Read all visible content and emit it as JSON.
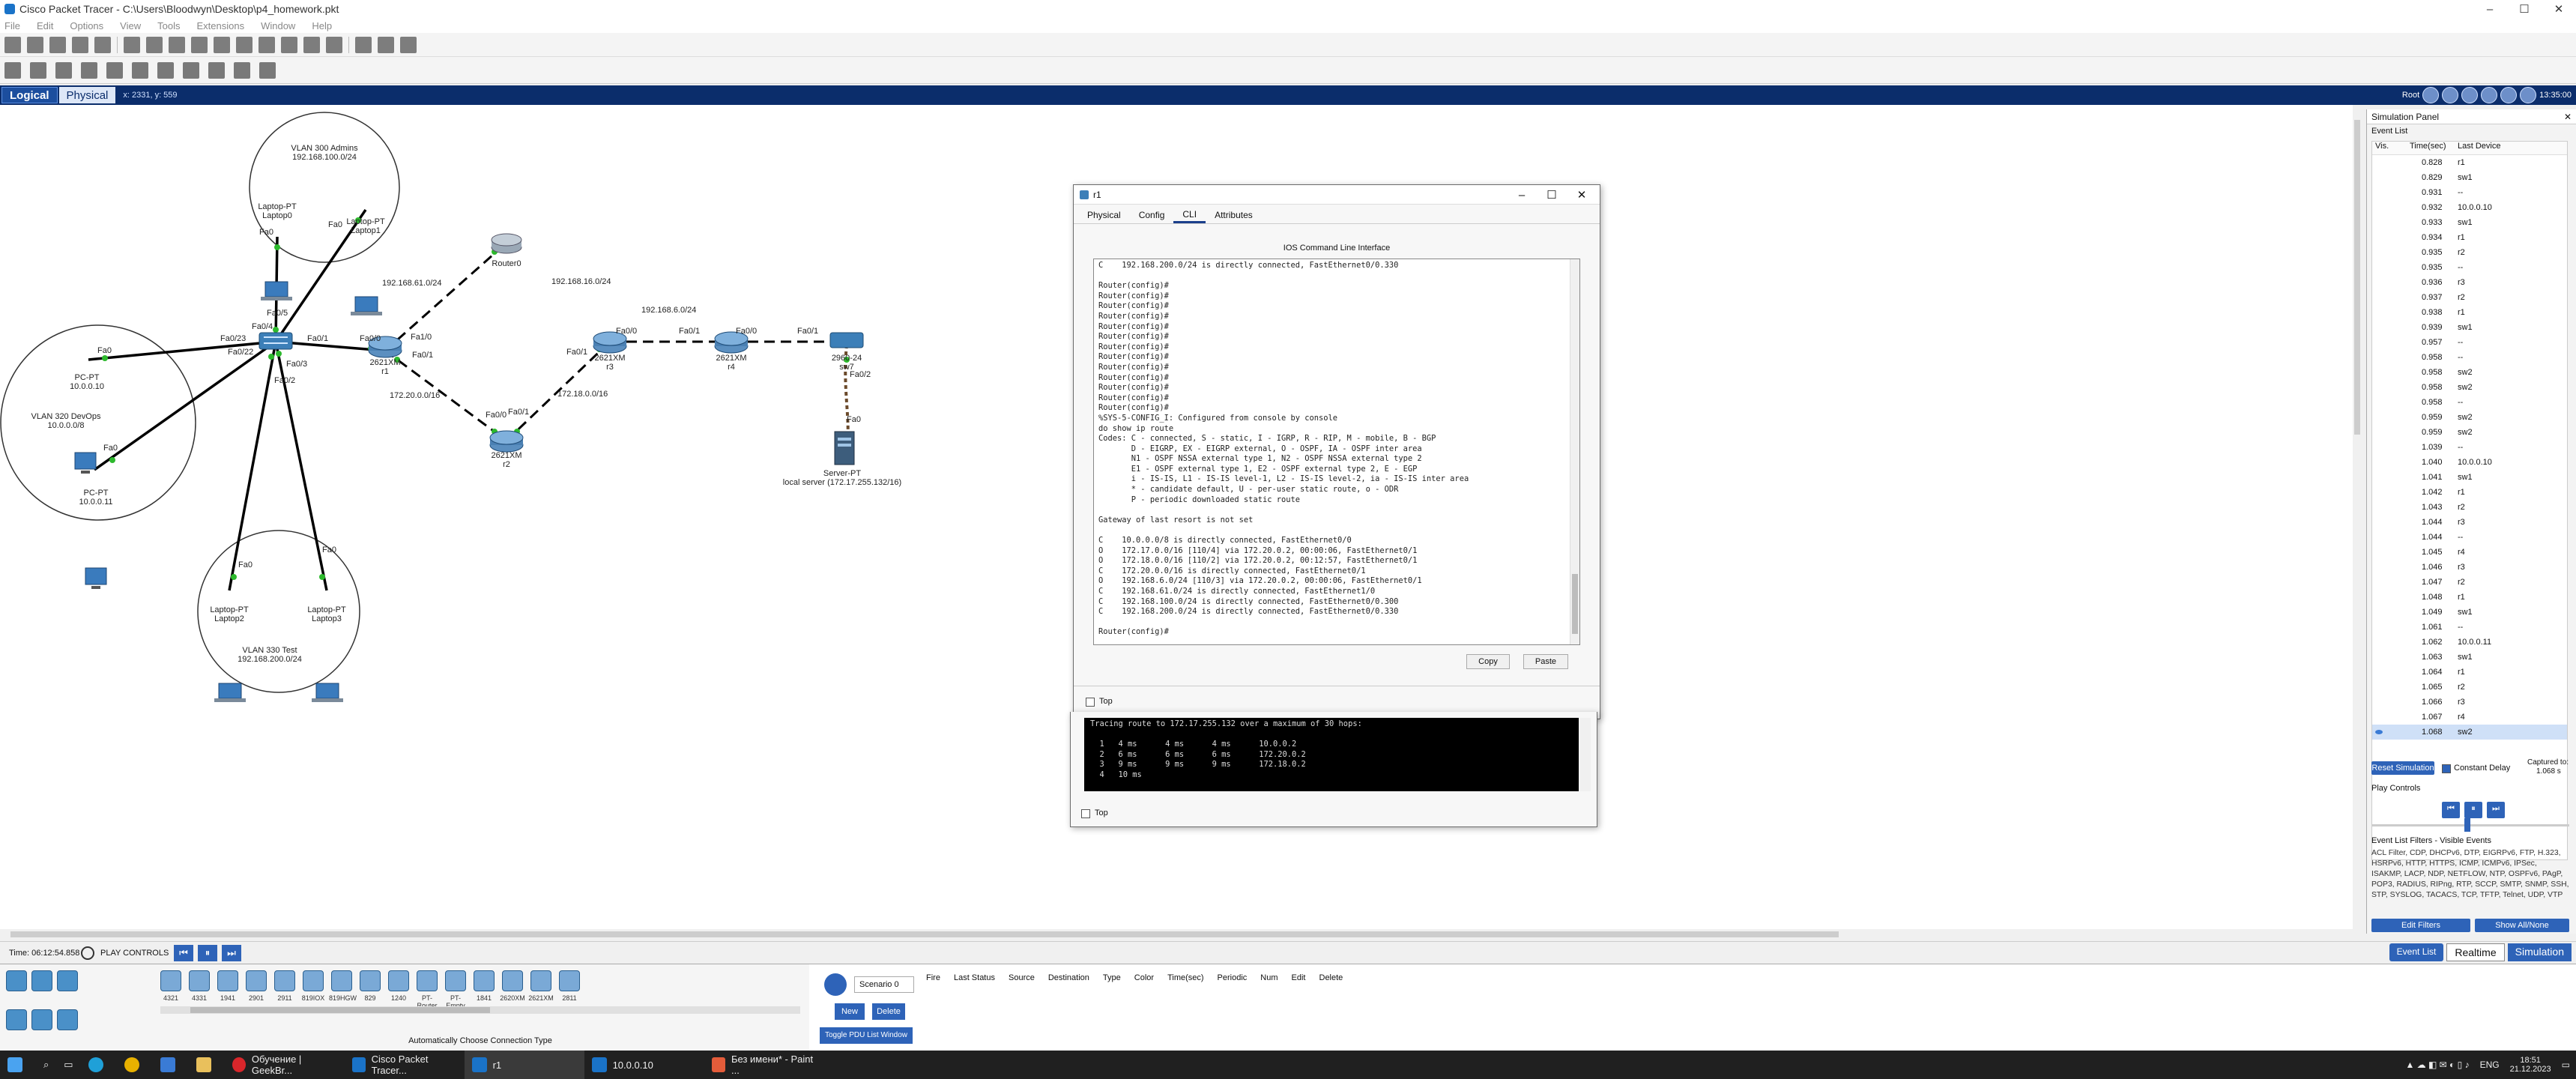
{
  "window": {
    "title": "Cisco Packet Tracer - C:\\Users\\Bloodwyn\\Desktop\\p4_homework.pkt"
  },
  "menu": [
    "File",
    "Edit",
    "Options",
    "View",
    "Tools",
    "Extensions",
    "Window",
    "Help"
  ],
  "mode_bar": {
    "logical": "Logical",
    "physical": "Physical",
    "coords": "x: 2331, y: 559",
    "root": "Root",
    "clock": "13:35:00"
  },
  "topology": {
    "vlans": [
      {
        "name": "VLAN 300 Admins",
        "subnet": "192.168.100.0/24"
      },
      {
        "name": "VLAN 320 DevOps",
        "subnet": "10.0.0.0/8"
      },
      {
        "name": "VLAN 330 Test",
        "subnet": "192.168.200.0/24"
      }
    ],
    "devices": {
      "laptop0": "Laptop-PT\nLaptop0",
      "laptop1": "Laptop-PT\nLaptop1",
      "pc0": "PC-PT\n10.0.0.10",
      "pc1": "PC-PT\n10.0.0.11",
      "laptop2": "Laptop-PT\nLaptop2",
      "laptop3": "Laptop-PT\nLaptop3",
      "r1": "2621XM\nr1",
      "r2": "2621XM\nr2",
      "r3": "2621XM\nr3",
      "r4": "2621XM\nr4",
      "r0": "Router0",
      "switch": "2960-24\nsw7",
      "server": "Server-PT\nlocal server (172.17.255.132/16)"
    },
    "nets": {
      "n1": "192.168.61.0/24",
      "n2": "192.168.16.0/24",
      "n3": "192.168.6.0/24",
      "n4": "172.20.0.0/16",
      "n5": "172.18.0.0/16"
    },
    "ports": [
      "Fa0",
      "Fa0",
      "Fa0/5",
      "Fa0/4",
      "Fa0/23",
      "Fa0/22",
      "Fa0/1",
      "Fa0/3",
      "Fa0/2",
      "Fa0/0",
      "Fa1/0",
      "Fa0/1",
      "Fa0/0",
      "Fa0/1",
      "Fa0/0",
      "Fa0/1",
      "Fa0/1",
      "Fa0/0",
      "Fa0/1",
      "Fa0/2",
      "Fa0",
      "Fa0",
      "Fa0",
      "Fa0",
      "Fa0",
      "Fa0/0",
      "Fa0/1"
    ]
  },
  "cli_window": {
    "title": "r1",
    "tabs": [
      "Physical",
      "Config",
      "CLI",
      "Attributes"
    ],
    "heading": "IOS Command Line Interface",
    "lines": [
      "C    192.168.200.0/24 is directly connected, FastEthernet0/0.330",
      "",
      "Router(config)#",
      "Router(config)#",
      "Router(config)#",
      "Router(config)#",
      "Router(config)#",
      "Router(config)#",
      "Router(config)#",
      "Router(config)#",
      "Router(config)#",
      "Router(config)#",
      "Router(config)#",
      "Router(config)#",
      "Router(config)#",
      "%SYS-5-CONFIG_I: Configured from console by console",
      "do show ip route",
      "Codes: C - connected, S - static, I - IGRP, R - RIP, M - mobile, B - BGP",
      "       D - EIGRP, EX - EIGRP external, O - OSPF, IA - OSPF inter area",
      "       N1 - OSPF NSSA external type 1, N2 - OSPF NSSA external type 2",
      "       E1 - OSPF external type 1, E2 - OSPF external type 2, E - EGP",
      "       i - IS-IS, L1 - IS-IS level-1, L2 - IS-IS level-2, ia - IS-IS inter area",
      "       * - candidate default, U - per-user static route, o - ODR",
      "       P - periodic downloaded static route",
      "",
      "Gateway of last resort is not set",
      "",
      "C    10.0.0.0/8 is directly connected, FastEthernet0/0",
      "O    172.17.0.0/16 [110/4] via 172.20.0.2, 00:00:06, FastEthernet0/1",
      "O    172.18.0.0/16 [110/2] via 172.20.0.2, 00:12:57, FastEthernet0/1",
      "C    172.20.0.0/16 is directly connected, FastEthernet0/1",
      "O    192.168.6.0/24 [110/3] via 172.20.0.2, 00:00:06, FastEthernet0/1",
      "C    192.168.61.0/24 is directly connected, FastEthernet1/0",
      "C    192.168.100.0/24 is directly connected, FastEthernet0/0.300",
      "C    192.168.200.0/24 is directly connected, FastEthernet0/0.330",
      "",
      "Router(config)#"
    ],
    "copy": "Copy",
    "paste": "Paste",
    "top": "Top"
  },
  "cmd_window": {
    "lines": [
      "Tracing route to 172.17.255.132 over a maximum of 30 hops:",
      "",
      "  1   4 ms      4 ms      4 ms      10.0.0.2",
      "  2   6 ms      6 ms      6 ms      172.20.0.2",
      "  3   9 ms      9 ms      9 ms      172.18.0.2",
      "  4   10 ms"
    ],
    "top": "Top"
  },
  "sim_panel": {
    "title": "Simulation Panel",
    "event_list": "Event List",
    "headers": [
      "Vis.",
      "Time(sec)",
      "Last Device"
    ],
    "rows": [
      [
        "0.828",
        "r1"
      ],
      [
        "0.829",
        "sw1"
      ],
      [
        "0.931",
        "--"
      ],
      [
        "0.932",
        "10.0.0.10"
      ],
      [
        "0.933",
        "sw1"
      ],
      [
        "0.934",
        "r1"
      ],
      [
        "0.935",
        "r2"
      ],
      [
        "0.935",
        "--"
      ],
      [
        "0.936",
        "r3"
      ],
      [
        "0.937",
        "r2"
      ],
      [
        "0.938",
        "r1"
      ],
      [
        "0.939",
        "sw1"
      ],
      [
        "0.957",
        "--"
      ],
      [
        "0.958",
        "--"
      ],
      [
        "0.958",
        "sw2"
      ],
      [
        "0.958",
        "sw2"
      ],
      [
        "0.958",
        "--"
      ],
      [
        "0.959",
        "sw2"
      ],
      [
        "0.959",
        "sw2"
      ],
      [
        "1.039",
        "--"
      ],
      [
        "1.040",
        "10.0.0.10"
      ],
      [
        "1.041",
        "sw1"
      ],
      [
        "1.042",
        "r1"
      ],
      [
        "1.043",
        "r2"
      ],
      [
        "1.044",
        "r3"
      ],
      [
        "1.044",
        "--"
      ],
      [
        "1.045",
        "r4"
      ],
      [
        "1.046",
        "r3"
      ],
      [
        "1.047",
        "r2"
      ],
      [
        "1.048",
        "r1"
      ],
      [
        "1.049",
        "sw1"
      ],
      [
        "1.061",
        "--"
      ],
      [
        "1.062",
        "10.0.0.11"
      ],
      [
        "1.063",
        "sw1"
      ],
      [
        "1.064",
        "r1"
      ],
      [
        "1.065",
        "r2"
      ],
      [
        "1.066",
        "r3"
      ],
      [
        "1.067",
        "r4"
      ],
      [
        "1.068",
        "sw2"
      ]
    ],
    "reset": "Reset Simulation",
    "constant_delay": "Constant Delay",
    "captured": "Captured to:",
    "captured_val": "1.068 s",
    "play_controls": "Play Controls",
    "filters_title": "Event List Filters - Visible Events",
    "filters": "ACL Filter, CDP, DHCPv6, DTP, EIGRPv6, FTP, H.323, HSRPv6, HTTP, HTTPS, ICMP, ICMPv6, IPSec, ISAKMP, LACP, NDP, NETFLOW, NTP, OSPFv6, PAgP, POP3, RADIUS, RIPng, RTP, SCCP, SMTP, SNMP, SSH, STP, SYSLOG, TACACS, TCP, TFTP, Telnet, UDP, VTP",
    "edit_filters": "Edit Filters",
    "show_all": "Show All/None"
  },
  "bottom": {
    "time": "Time: 06:12:54.858",
    "play_controls": "PLAY CONTROLS",
    "device_models": [
      "4321",
      "4331",
      "1941",
      "2901",
      "2911",
      "819IOX",
      "819HGW",
      "829",
      "1240",
      "PT-Router",
      "PT-Empty",
      "1841",
      "2620XM",
      "2621XM",
      "2811"
    ],
    "connection_hint": "Automatically Choose Connection Type",
    "scenario": "Scenario 0",
    "new": "New",
    "delete": "Delete",
    "toggle_pdu": "Toggle PDU List Window",
    "pdu_headers": [
      "Fire",
      "Last Status",
      "Source",
      "Destination",
      "Type",
      "Color",
      "Time(sec)",
      "Periodic",
      "Num",
      "Edit",
      "Delete"
    ],
    "event_list": "Event List",
    "realtime": "Realtime",
    "simulation": "Simulation"
  },
  "taskbar": {
    "items": [
      "Обучение | GeekBr...",
      "Cisco Packet Tracer...",
      "r1",
      "10.0.0.10",
      "Без имени* - Paint ..."
    ],
    "lang": "ENG",
    "time": "18:51",
    "date": "21.12.2023"
  }
}
